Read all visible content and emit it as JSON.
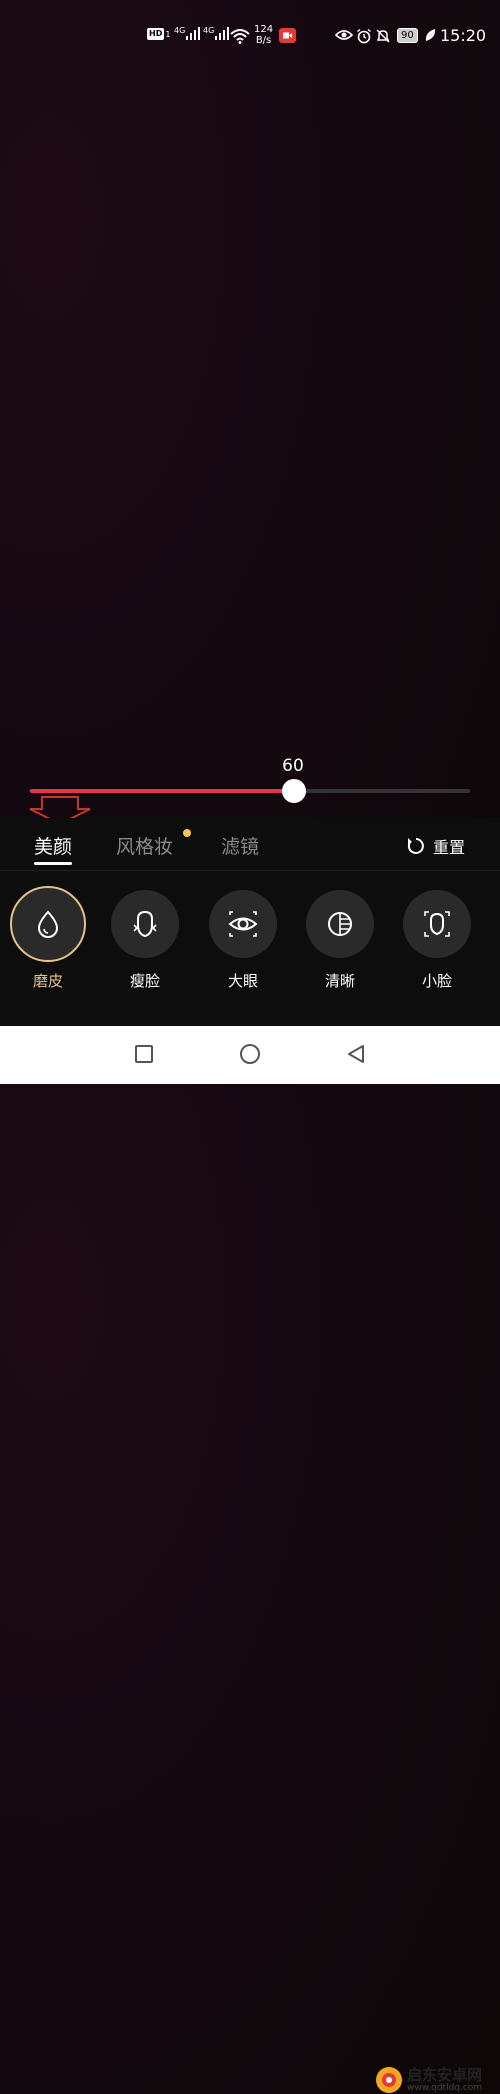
{
  "status_bar": {
    "hd": "HD",
    "sim": "1",
    "network1": "4G",
    "network2": "4G",
    "speed_value": "124",
    "speed_unit": "B/s",
    "battery": "90",
    "time": "15:20"
  },
  "slider": {
    "value": "60",
    "level_percent": 60,
    "fill_color": "#e0394b"
  },
  "tabs": [
    {
      "label": "美颜",
      "active": true
    },
    {
      "label": "风格妆",
      "active": false,
      "badge": true
    },
    {
      "label": "滤镜",
      "active": false
    }
  ],
  "reset_label": "重置",
  "tools": [
    {
      "label": "磨皮",
      "icon": "droplet-icon",
      "selected": true
    },
    {
      "label": "瘦脸",
      "icon": "face-slim-icon",
      "selected": false
    },
    {
      "label": "大眼",
      "icon": "eye-icon",
      "selected": false
    },
    {
      "label": "清晰",
      "icon": "clarity-icon",
      "selected": false
    },
    {
      "label": "小脸",
      "icon": "small-face-icon",
      "selected": false
    }
  ],
  "colors": {
    "accent": "#e0394b",
    "selected": "#e8c285",
    "badge": "#f5c84a",
    "arrow": "#c0392b"
  },
  "watermark": {
    "name": "启东安卓网",
    "url": "www.qdtldq.com"
  }
}
